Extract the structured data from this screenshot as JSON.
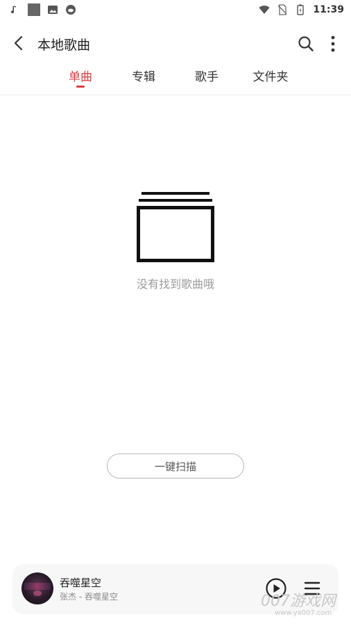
{
  "status_bar": {
    "time": "11:39",
    "left_icons": [
      "music-note-icon",
      "square-icon",
      "image-icon",
      "cloud-icon"
    ],
    "right_icons": [
      "wifi-icon",
      "no-sim-icon",
      "battery-icon"
    ]
  },
  "header": {
    "title": "本地歌曲",
    "back_icon": "chevron-left-icon",
    "search_icon": "search-icon",
    "more_icon": "more-vertical-icon"
  },
  "tabs": [
    {
      "label": "单曲",
      "active": true
    },
    {
      "label": "专辑",
      "active": false
    },
    {
      "label": "歌手",
      "active": false
    },
    {
      "label": "文件夹",
      "active": false
    }
  ],
  "empty_state": {
    "icon": "empty-folder-stack-icon",
    "message": "没有找到歌曲哦",
    "scan_button_label": "一键扫描"
  },
  "mini_player": {
    "song_title": "吞噬星空",
    "song_subtitle": "张杰 - 吞噬星空",
    "play_icon": "play-circle-icon",
    "playlist_icon": "playlist-icon"
  },
  "watermark": {
    "logo": "007游戏网",
    "url": "www.yx007.com"
  },
  "colors": {
    "accent": "#e03a3a",
    "text_primary": "#222222",
    "text_muted": "#9a9a9a",
    "divider": "#eeeeee"
  }
}
